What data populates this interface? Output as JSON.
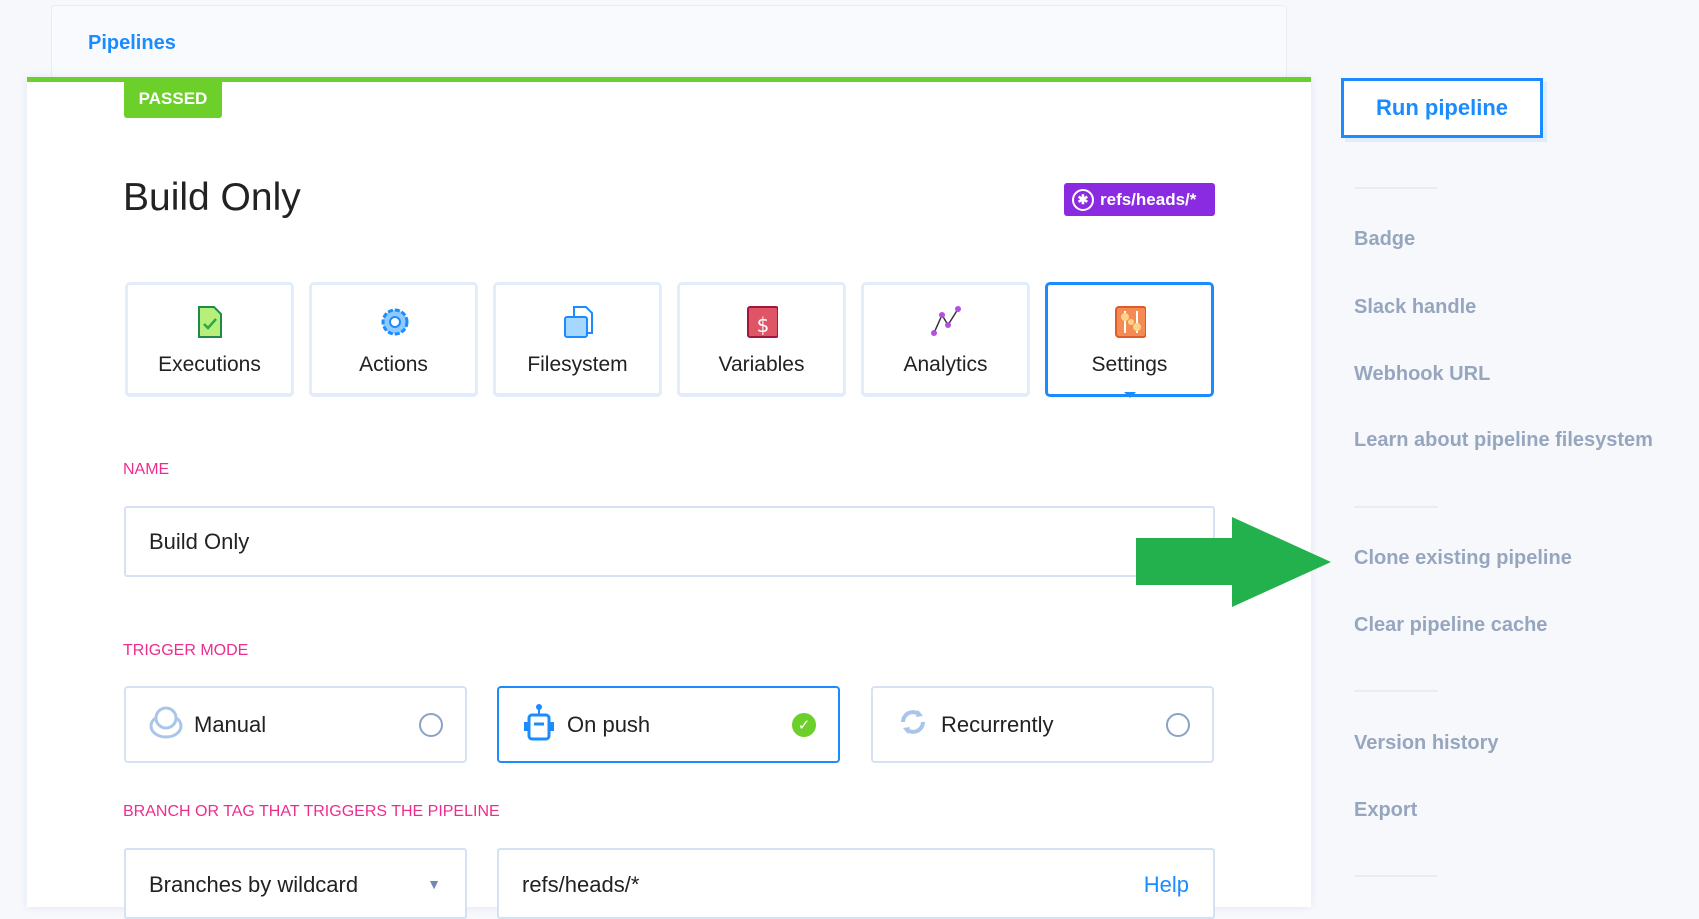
{
  "breadcrumb": {
    "pipelines": "Pipelines"
  },
  "status": {
    "label": "PASSED",
    "color": "#6ccf2a"
  },
  "pipeline": {
    "title": "Build Only",
    "branch_badge": "refs/heads/*"
  },
  "tabs": [
    {
      "label": "Executions",
      "icon": "file-check-icon"
    },
    {
      "label": "Actions",
      "icon": "gear-icon"
    },
    {
      "label": "Filesystem",
      "icon": "folder-files-icon"
    },
    {
      "label": "Variables",
      "icon": "dollar-icon"
    },
    {
      "label": "Analytics",
      "icon": "line-chart-icon"
    },
    {
      "label": "Settings",
      "icon": "sliders-icon",
      "active": true
    }
  ],
  "form": {
    "name_label": "NAME",
    "name_value": "Build Only",
    "trigger_label": "TRIGGER MODE",
    "trigger_options": [
      {
        "label": "Manual",
        "selected": false
      },
      {
        "label": "On push",
        "selected": true
      },
      {
        "label": "Recurrently",
        "selected": false
      }
    ],
    "branch_label": "BRANCH OR TAG THAT TRIGGERS THE PIPELINE",
    "branch_mode": "Branches by wildcard",
    "branch_value": "refs/heads/*",
    "help": "Help"
  },
  "sidebar": {
    "run_button": "Run pipeline",
    "links": [
      "Badge",
      "Slack handle",
      "Webhook URL",
      "Learn about pipeline filesystem",
      "Clone existing pipeline",
      "Clear pipeline cache",
      "Version history",
      "Export"
    ]
  },
  "colors": {
    "accent": "#1a8cff",
    "label": "#ec2d8e",
    "arrow": "#22b14c",
    "badge": "#8a2be2"
  }
}
